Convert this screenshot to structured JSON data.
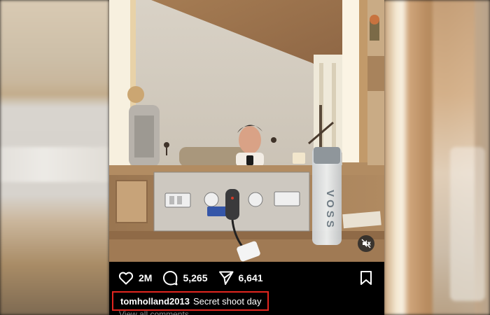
{
  "post": {
    "photo_alt": "mirror selfie",
    "mute_icon": "speaker-muted-icon",
    "water_bottle_text": "VOSS"
  },
  "actions": {
    "likes": "2M",
    "comments": "5,265",
    "shares": "6,641",
    "like_icon": "heart-icon",
    "comment_icon": "comment-bubble-icon",
    "share_icon": "paper-plane-icon",
    "save_icon": "bookmark-icon"
  },
  "caption": {
    "username": "tomholland2013",
    "text": "Secret shoot day",
    "highlight_color": "#e3261f"
  },
  "comments_link": "View all comments",
  "colors": {
    "background": "#000000",
    "text": "#ffffff",
    "muted_text": "#8a8a8a"
  }
}
